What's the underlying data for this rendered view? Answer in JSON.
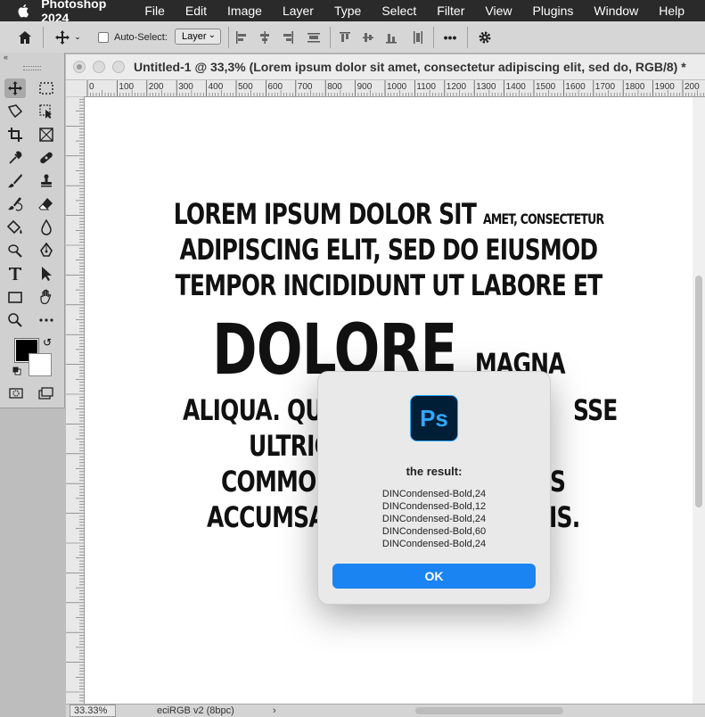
{
  "menubar": {
    "app_name": "Photoshop 2024",
    "items": [
      "File",
      "Edit",
      "Image",
      "Layer",
      "Type",
      "Select",
      "Filter",
      "View",
      "Plugins",
      "Window",
      "Help"
    ]
  },
  "options_bar": {
    "auto_select_label": "Auto-Select:",
    "layer_select_value": "Layer",
    "more_label": "•••"
  },
  "document": {
    "title": "Untitled-1 @ 33,3% (Lorem ipsum dolor sit amet, consectetur adipiscing elit, sed do, RGB/8) *",
    "ruler_h_labels": [
      "0",
      "100",
      "200",
      "300",
      "400",
      "500",
      "600",
      "700",
      "800",
      "900",
      "1000",
      "1100",
      "1200",
      "1300",
      "1400",
      "1500",
      "1600",
      "1700",
      "1800",
      "1900",
      "200"
    ],
    "zoom": "33.33%",
    "profile": "eciRGB v2 (8bpc)",
    "status_arrow": "›"
  },
  "canvas_text": {
    "line1_big": "LOREM IPSUM DOLOR SIT",
    "line1_small": "AMET, CONSECTETUR",
    "line2": "ADIPISCING ELIT, SED DO EIUSMOD",
    "line3": "TEMPOR INCIDIDUNT UT LABORE ET",
    "line4_big": "DOLORE",
    "line4_small": "MAGNA",
    "line5_left": "ALIQUA. QU",
    "line5_right": "SSE",
    "line6_left": "ULTRIC",
    "line7_left": "COMMOD",
    "line7_right": "S",
    "line8_left": "ACCUMSA",
    "line8_right": "IS."
  },
  "dialog": {
    "logo_text": "Ps",
    "title": "the result:",
    "lines": [
      "DINCondensed-Bold,24",
      "DINCondensed-Bold,12",
      "DINCondensed-Bold,24",
      "DINCondensed-Bold,60",
      "DINCondensed-Bold,24"
    ],
    "ok_label": "OK"
  },
  "colors": {
    "menubar_bg": "#2a2a2a",
    "ok_button": "#1a84f2",
    "ps_logo_bg": "#001e36",
    "ps_logo_fg": "#31a8ff",
    "foreground_color": "#000000",
    "background_color": "#ffffff"
  }
}
